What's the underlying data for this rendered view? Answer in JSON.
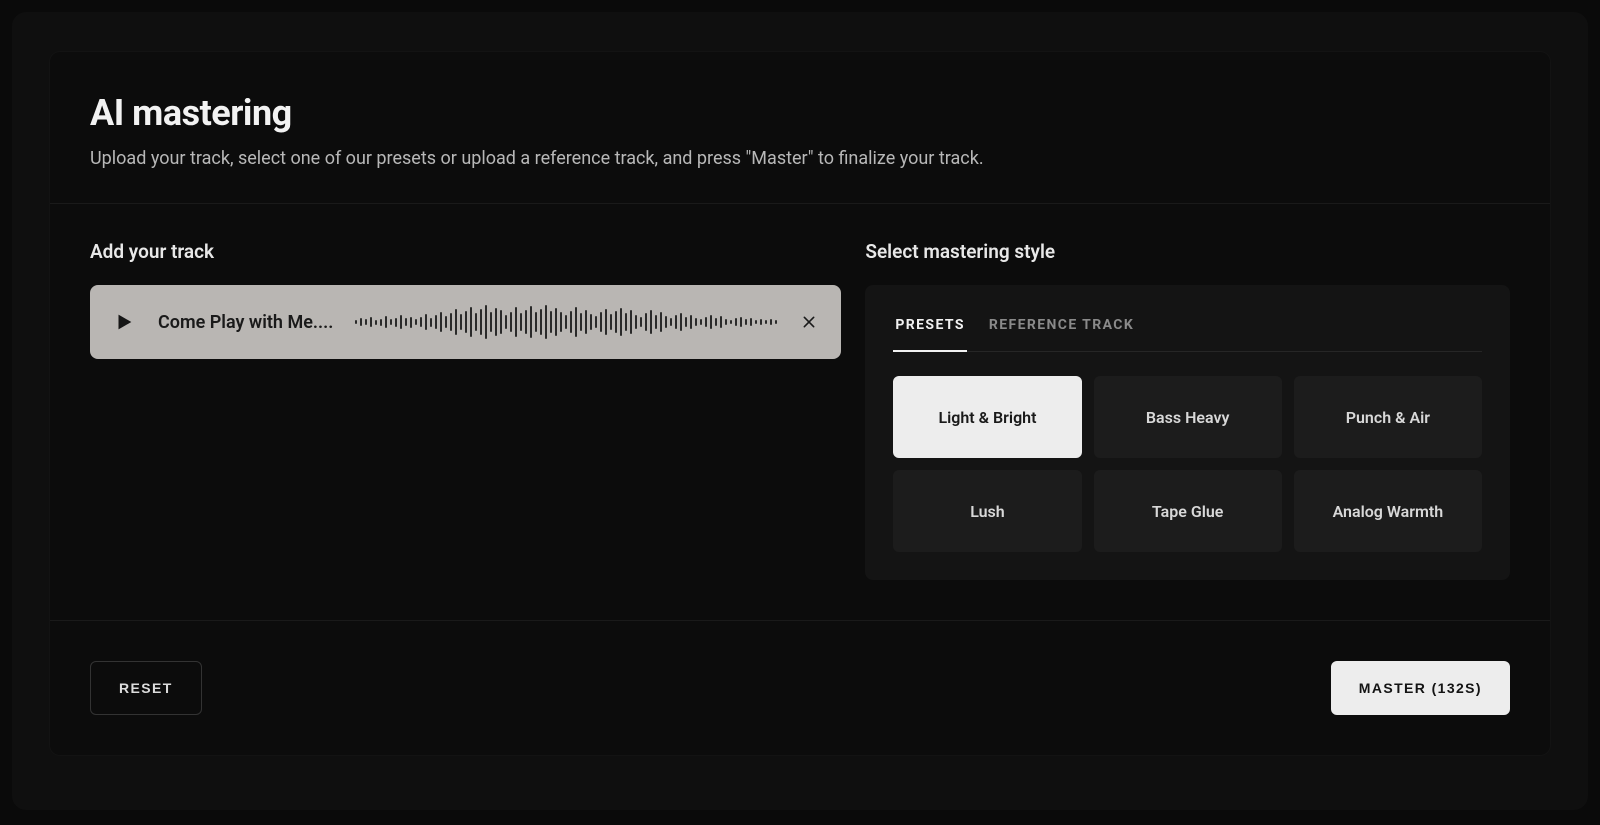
{
  "header": {
    "title": "AI mastering",
    "subtitle": "Upload your track, select one of our presets or upload a reference track, and press \"Master\" to finalize your track."
  },
  "left": {
    "section_label": "Add your track",
    "track": {
      "name": "Come Play with Me...."
    }
  },
  "right": {
    "section_label": "Select mastering style",
    "tabs": {
      "presets": "PRESETS",
      "reference_track": "REFERENCE TRACK",
      "active": "presets"
    },
    "presets": [
      {
        "label": "Light & Bright",
        "selected": true
      },
      {
        "label": "Bass Heavy",
        "selected": false
      },
      {
        "label": "Punch & Air",
        "selected": false
      },
      {
        "label": "Lush",
        "selected": false
      },
      {
        "label": "Tape Glue",
        "selected": false
      },
      {
        "label": "Analog Warmth",
        "selected": false
      }
    ]
  },
  "footer": {
    "reset_label": "RESET",
    "master_label": "MASTER (132S)"
  },
  "waveform": [
    4,
    8,
    6,
    10,
    5,
    7,
    12,
    6,
    9,
    14,
    8,
    11,
    6,
    10,
    16,
    9,
    14,
    20,
    12,
    18,
    26,
    16,
    22,
    30,
    18,
    26,
    34,
    20,
    28,
    24,
    14,
    20,
    30,
    18,
    24,
    32,
    20,
    26,
    34,
    22,
    28,
    20,
    14,
    22,
    30,
    18,
    24,
    16,
    12,
    20,
    26,
    16,
    22,
    28,
    18,
    24,
    14,
    10,
    18,
    24,
    14,
    20,
    12,
    8,
    14,
    18,
    10,
    14,
    8,
    6,
    10,
    14,
    8,
    12,
    6,
    4,
    8,
    10,
    6,
    8,
    4,
    6,
    4,
    6,
    4
  ],
  "colors": {
    "bg": "#0a0a0a",
    "panel": "#0c0c0c",
    "accent_light": "#ededed",
    "track_card": "#b9b6b3"
  }
}
